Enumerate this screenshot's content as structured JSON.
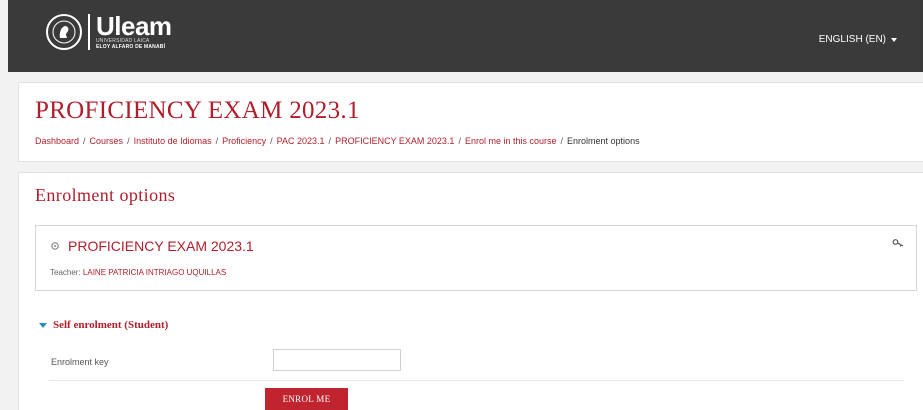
{
  "header": {
    "logo": {
      "name": "Uleam",
      "line1": "UNIVERSIDAD LAICA",
      "line2": "ELOY ALFARO DE MANABÍ"
    },
    "language": "ENGLISH (EN)"
  },
  "course": {
    "title": "PROFICIENCY EXAM 2023.1"
  },
  "breadcrumb": {
    "items": [
      "Dashboard",
      "Courses",
      "Instituto de Idiomas",
      "Proficiency",
      "PAC 2023.1",
      "PROFICIENCY EXAM 2023.1",
      "Enrol me in this course"
    ],
    "current": "Enrolment options",
    "separator": "/"
  },
  "enrolment": {
    "heading": "Enrolment options",
    "course_box": {
      "title": "PROFICIENCY EXAM 2023.1",
      "teacher_label": "Teacher:",
      "teacher_name": "LAINE PATRICIA INTRIAGO UQUILLAS"
    },
    "self_enrolment": {
      "heading": "Self enrolment (Student)",
      "key_label": "Enrolment key",
      "key_value": "",
      "button_label": "ENROL ME"
    }
  },
  "colors": {
    "topbar": "#3a3a3a",
    "accent": "#b01e2b",
    "button": "#c0242f",
    "collapse_icon": "#2a8bc0"
  }
}
